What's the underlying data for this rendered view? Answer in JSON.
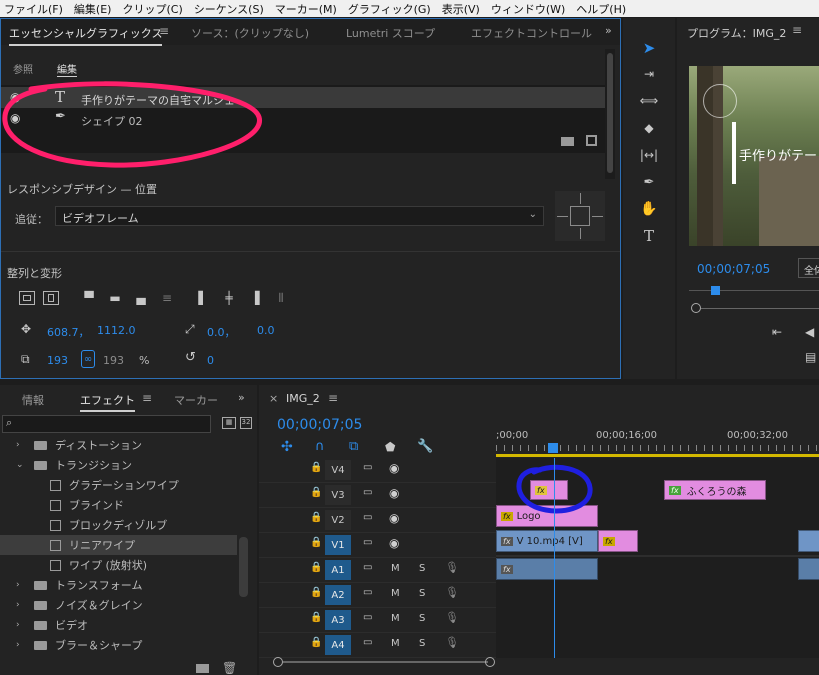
{
  "menu": [
    "ファイル(F)",
    "編集(E)",
    "クリップ(C)",
    "シーケンス(S)",
    "マーカー(M)",
    "グラフィック(G)",
    "表示(V)",
    "ウィンドウ(W)",
    "ヘルプ(H)"
  ],
  "top_panel": {
    "tabs": [
      "エッセンシャルグラフィックス",
      "ソース：(クリップなし)",
      "Lumetri スコープ",
      "エフェクトコントロール"
    ],
    "subtabs": [
      "参照",
      "編集"
    ],
    "layers": [
      {
        "icon": "text-icon",
        "label": "手作りがテーマの自宅マルシェ"
      },
      {
        "icon": "pen-icon",
        "label": "シェイプ 02"
      }
    ],
    "responsive_title": "レスポンシブデザイン — 位置",
    "follow_label": "追従：",
    "follow_value": "ビデオフレーム",
    "align_title": "整列と変形",
    "pos_x": "608.7，",
    "pos_y": "1112.0",
    "anchor_x": "0.0，",
    "anchor_y": "0.0",
    "scale": "193",
    "scale_locked": "193",
    "scale_unit": "%",
    "rotation": "0"
  },
  "program": {
    "title": "プログラム：IMG_2",
    "overlay_text": "手作りがテー",
    "timecode": "00;00;07;05",
    "fit_label": "全体"
  },
  "effects_panel": {
    "tabs": [
      "情報",
      "エフェクト",
      "マーカー"
    ],
    "search_placeholder": "",
    "tree": [
      {
        "label": "ディストーション",
        "type": "folder",
        "expanded": false,
        "indent": 1
      },
      {
        "label": "トランジション",
        "type": "folder",
        "expanded": true,
        "indent": 1
      },
      {
        "label": "グラデーションワイプ",
        "type": "effect",
        "indent": 2
      },
      {
        "label": "ブラインド",
        "type": "effect",
        "indent": 2
      },
      {
        "label": "ブロックディゾルブ",
        "type": "effect",
        "indent": 2
      },
      {
        "label": "リニアワイプ",
        "type": "effect",
        "indent": 2,
        "selected": true
      },
      {
        "label": "ワイプ (放射状)",
        "type": "effect",
        "indent": 2
      },
      {
        "label": "トランスフォーム",
        "type": "folder",
        "expanded": false,
        "indent": 1
      },
      {
        "label": "ノイズ＆グレイン",
        "type": "folder",
        "expanded": false,
        "indent": 1
      },
      {
        "label": "ビデオ",
        "type": "folder",
        "expanded": false,
        "indent": 1
      },
      {
        "label": "ブラー＆シャープ",
        "type": "folder",
        "expanded": false,
        "indent": 1
      }
    ]
  },
  "timeline": {
    "title": "IMG_2",
    "timecode": "00;00;07;05",
    "ruler": [
      ";00;00",
      "00;00;16;00",
      "00;00;32;00"
    ],
    "video_tracks": [
      "V4",
      "V3",
      "V2",
      "V1"
    ],
    "audio_tracks": [
      "A1",
      "A2",
      "A3",
      "A4"
    ],
    "m_label": "M",
    "s_label": "S",
    "clips": {
      "v3_fx": "fx",
      "v3_owl_fx": "fx",
      "v3_owl": "ふくろうの森",
      "v2_fx": "fx",
      "v2_logo": "Logo",
      "v1_fx": "fx",
      "v1_main": "V 10.mp4 [V]",
      "v1_pink_fx": "fx",
      "a1_fx": "fx"
    }
  },
  "colors": {
    "accent_blue": "#2d8ceb",
    "annotation_pink": "#ff1f6b",
    "annotation_blue": "#1f1fe0",
    "clip_pink": "#e28ce0",
    "clip_blue": "#6f95c6",
    "track_active": "#1f5a8c"
  }
}
